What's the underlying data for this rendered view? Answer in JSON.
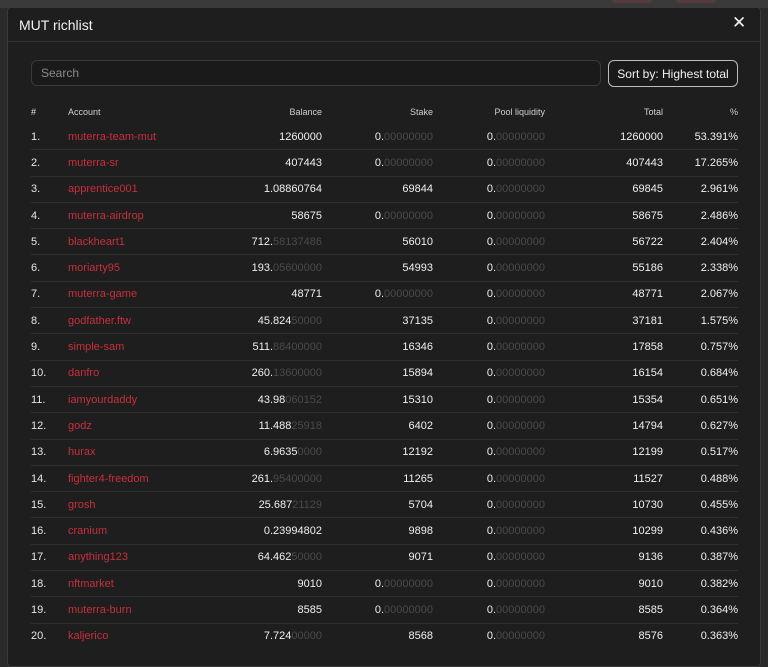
{
  "modal": {
    "title": "MUT richlist",
    "close_glyph": "✕",
    "search_placeholder": "Search",
    "sort_label": "Sort by: Highest total"
  },
  "columns": [
    "#",
    "Account",
    "Balance",
    "Stake",
    "Pool liquidity",
    "Total",
    "%"
  ],
  "rows": [
    {
      "rank": "1.",
      "account": "muterra-team-mut",
      "balance": [
        "1260000",
        ""
      ],
      "stake": [
        "0.",
        "00000000"
      ],
      "pool": [
        "0.",
        "00000000"
      ],
      "total": "1260000",
      "pct": "53.391%"
    },
    {
      "rank": "2.",
      "account": "muterra-sr",
      "balance": [
        "407443",
        ""
      ],
      "stake": [
        "0.",
        "00000000"
      ],
      "pool": [
        "0.",
        "00000000"
      ],
      "total": "407443",
      "pct": "17.265%"
    },
    {
      "rank": "3.",
      "account": "apprentice001",
      "balance": [
        "1.08860764",
        ""
      ],
      "stake": [
        "69844",
        ""
      ],
      "pool": [
        "0.",
        "00000000"
      ],
      "total": "69845",
      "pct": "2.961%"
    },
    {
      "rank": "4.",
      "account": "muterra-airdrop",
      "balance": [
        "58675",
        ""
      ],
      "stake": [
        "0.",
        "00000000"
      ],
      "pool": [
        "0.",
        "00000000"
      ],
      "total": "58675",
      "pct": "2.486%"
    },
    {
      "rank": "5.",
      "account": "blackheart1",
      "balance": [
        "712.",
        "58137486"
      ],
      "stake": [
        "56010",
        ""
      ],
      "pool": [
        "0.",
        "00000000"
      ],
      "total": "56722",
      "pct": "2.404%"
    },
    {
      "rank": "6.",
      "account": "moriarty95",
      "balance": [
        "193.",
        "05600000"
      ],
      "stake": [
        "54993",
        ""
      ],
      "pool": [
        "0.",
        "00000000"
      ],
      "total": "55186",
      "pct": "2.338%"
    },
    {
      "rank": "7.",
      "account": "muterra-game",
      "balance": [
        "48771",
        ""
      ],
      "stake": [
        "0.",
        "00000000"
      ],
      "pool": [
        "0.",
        "00000000"
      ],
      "total": "48771",
      "pct": "2.067%"
    },
    {
      "rank": "8.",
      "account": "godfather.ftw",
      "balance": [
        "45.824",
        "50000"
      ],
      "stake": [
        "37135",
        ""
      ],
      "pool": [
        "0.",
        "00000000"
      ],
      "total": "37181",
      "pct": "1.575%"
    },
    {
      "rank": "9.",
      "account": "simple-sam",
      "balance": [
        "511.",
        "88400000"
      ],
      "stake": [
        "16346",
        ""
      ],
      "pool": [
        "0.",
        "00000000"
      ],
      "total": "17858",
      "pct": "0.757%"
    },
    {
      "rank": "10.",
      "account": "danfro",
      "balance": [
        "260.",
        "13600000"
      ],
      "stake": [
        "15894",
        ""
      ],
      "pool": [
        "0.",
        "00000000"
      ],
      "total": "16154",
      "pct": "0.684%"
    },
    {
      "rank": "11.",
      "account": "iamyourdaddy",
      "balance": [
        "43.98",
        "060152"
      ],
      "stake": [
        "15310",
        ""
      ],
      "pool": [
        "0.",
        "00000000"
      ],
      "total": "15354",
      "pct": "0.651%"
    },
    {
      "rank": "12.",
      "account": "godz",
      "balance": [
        "11.488",
        "25918"
      ],
      "stake": [
        "6402",
        ""
      ],
      "pool": [
        "0.",
        "00000000"
      ],
      "total": "14794",
      "pct": "0.627%"
    },
    {
      "rank": "13.",
      "account": "hurax",
      "balance": [
        "6.9635",
        "0000"
      ],
      "stake": [
        "12192",
        ""
      ],
      "pool": [
        "0.",
        "00000000"
      ],
      "total": "12199",
      "pct": "0.517%"
    },
    {
      "rank": "14.",
      "account": "fighter4-freedom",
      "balance": [
        "261.",
        "95400000"
      ],
      "stake": [
        "11265",
        ""
      ],
      "pool": [
        "0.",
        "00000000"
      ],
      "total": "11527",
      "pct": "0.488%"
    },
    {
      "rank": "15.",
      "account": "grosh",
      "balance": [
        "25.687",
        "21129"
      ],
      "stake": [
        "5704",
        ""
      ],
      "pool": [
        "0.",
        "00000000"
      ],
      "total": "10730",
      "pct": "0.455%"
    },
    {
      "rank": "16.",
      "account": "cranium",
      "balance": [
        "0.23994802",
        ""
      ],
      "stake": [
        "9898",
        ""
      ],
      "pool": [
        "0.",
        "00000000"
      ],
      "total": "10299",
      "pct": "0.436%"
    },
    {
      "rank": "17.",
      "account": "anything123",
      "balance": [
        "64.462",
        "50000"
      ],
      "stake": [
        "9071",
        ""
      ],
      "pool": [
        "0.",
        "00000000"
      ],
      "total": "9136",
      "pct": "0.387%"
    },
    {
      "rank": "18.",
      "account": "nftmarket",
      "balance": [
        "9010",
        ""
      ],
      "stake": [
        "0.",
        "00000000"
      ],
      "pool": [
        "0.",
        "00000000"
      ],
      "total": "9010",
      "pct": "0.382%"
    },
    {
      "rank": "19.",
      "account": "muterra-burn",
      "balance": [
        "8585",
        ""
      ],
      "stake": [
        "0.",
        "00000000"
      ],
      "pool": [
        "0.",
        "00000000"
      ],
      "total": "8585",
      "pct": "0.364%"
    },
    {
      "rank": "20.",
      "account": "kaljerico",
      "balance": [
        "7.724",
        "00000"
      ],
      "stake": [
        "8568",
        ""
      ],
      "pool": [
        "0.",
        "00000000"
      ],
      "total": "8576",
      "pct": "0.363%"
    }
  ],
  "colors": {
    "background": "#1e1e1e",
    "account_link": "#c72f3c",
    "dim_decimals": "#4a4a4a",
    "text": "#f0f0f0"
  }
}
